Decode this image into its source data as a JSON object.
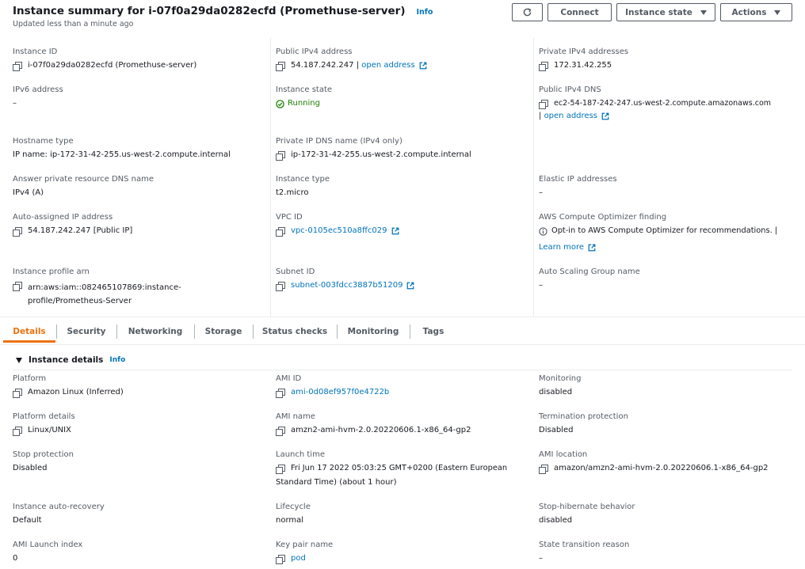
{
  "header": {
    "title": "Instance summary for i-07f0a29da0282ecfd (Promethuse-server)",
    "info": "Info",
    "subtitle": "Updated less than a minute ago",
    "buttons": {
      "connect": "Connect",
      "instance_state": "Instance state",
      "actions": "Actions"
    }
  },
  "summary": {
    "instance_id": {
      "label": "Instance ID",
      "value": "i-07f0a29da0282ecfd (Promethuse-server)"
    },
    "public_ipv4": {
      "label": "Public IPv4 address",
      "value": "54.187.242.247",
      "link": "open address"
    },
    "private_ipv4": {
      "label": "Private IPv4 addresses",
      "value": "172.31.42.255"
    },
    "ipv6": {
      "label": "IPv6 address",
      "value": "–"
    },
    "instance_state": {
      "label": "Instance state",
      "value": "Running"
    },
    "public_dns": {
      "label": "Public IPv4 DNS",
      "value": "ec2-54-187-242-247.us-west-2.compute.amazonaws.com",
      "link": "open address"
    },
    "hostname_type": {
      "label": "Hostname type",
      "value": "IP name: ip-172-31-42-255.us-west-2.compute.internal"
    },
    "private_dns": {
      "label": "Private IP DNS name (IPv4 only)",
      "value": "ip-172-31-42-255.us-west-2.compute.internal"
    },
    "answer_dns": {
      "label": "Answer private resource DNS name",
      "value": "IPv4 (A)"
    },
    "instance_type": {
      "label": "Instance type",
      "value": "t2.micro"
    },
    "elastic_ip": {
      "label": "Elastic IP addresses",
      "value": "–"
    },
    "auto_ip": {
      "label": "Auto-assigned IP address",
      "value": "54.187.242.247 [Public IP]"
    },
    "vpc_id": {
      "label": "VPC ID",
      "value": "vpc-0105ec510a8ffc029"
    },
    "optimizer": {
      "label": "AWS Compute Optimizer finding",
      "value": "Opt-in to AWS Compute Optimizer for recommendations.",
      "link": "Learn more"
    },
    "profile_arn": {
      "label": "Instance profile arn",
      "value_line1": "arn:aws:iam::082465107869:instance-",
      "value_line2": "profile/Prometheus-Server"
    },
    "subnet_id": {
      "label": "Subnet ID",
      "value": "subnet-003fdcc3887b51209"
    },
    "asg": {
      "label": "Auto Scaling Group name",
      "value": "–"
    }
  },
  "tabs": [
    "Details",
    "Security",
    "Networking",
    "Storage",
    "Status checks",
    "Monitoring",
    "Tags"
  ],
  "details": {
    "section_title": "Instance details",
    "info": "Info",
    "platform": {
      "label": "Platform",
      "value": "Amazon Linux (Inferred)"
    },
    "ami_id": {
      "label": "AMI ID",
      "value": "ami-0d08ef957f0e4722b"
    },
    "monitoring": {
      "label": "Monitoring",
      "value": "disabled"
    },
    "platform_details": {
      "label": "Platform details",
      "value": "Linux/UNIX"
    },
    "ami_name": {
      "label": "AMI name",
      "value": "amzn2-ami-hvm-2.0.20220606.1-x86_64-gp2"
    },
    "termination": {
      "label": "Termination protection",
      "value": "Disabled"
    },
    "stop_protection": {
      "label": "Stop protection",
      "value": "Disabled"
    },
    "launch_time": {
      "label": "Launch time",
      "value_line1": "Fri Jun 17 2022 05:03:25 GMT+0200 (Eastern European",
      "value_line2": "Standard Time) (about 1 hour)"
    },
    "ami_location": {
      "label": "AMI location",
      "value": "amazon/amzn2-ami-hvm-2.0.20220606.1-x86_64-gp2"
    },
    "auto_recovery": {
      "label": "Instance auto-recovery",
      "value": "Default"
    },
    "lifecycle": {
      "label": "Lifecycle",
      "value": "normal"
    },
    "stop_hibernate": {
      "label": "Stop-hibernate behavior",
      "value": "disabled"
    },
    "launch_index": {
      "label": "AMI Launch index",
      "value": "0"
    },
    "key_pair": {
      "label": "Key pair name",
      "value": "pod"
    },
    "state_reason": {
      "label": "State transition reason",
      "value": "–"
    }
  },
  "colors": {
    "link": "#0073bb",
    "active_tab": "#ec7211",
    "running": "#1d8102"
  }
}
